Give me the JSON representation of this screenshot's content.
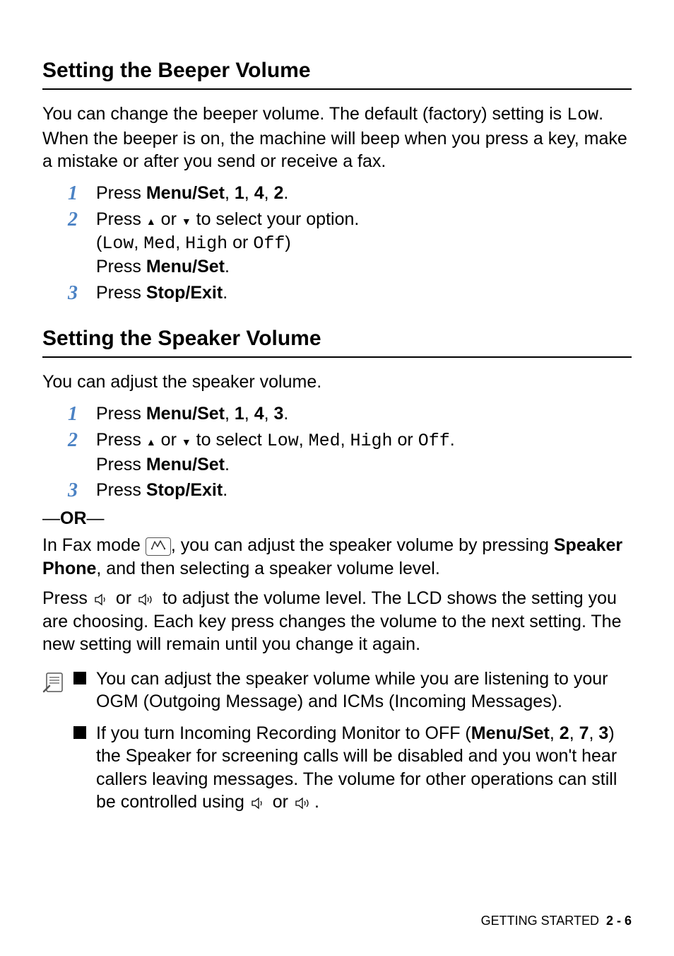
{
  "sections": {
    "beeper": {
      "heading": "Setting the Beeper Volume",
      "intro_pre": "You can change the beeper volume. The default (factory) setting is ",
      "intro_low": "Low",
      "intro_post": ". When the beeper is on, the machine will beep when you press a key, make a mistake or after you send or receive a fax.",
      "step1_pre": "Press ",
      "step1_bold": "Menu/Set",
      "step1_post": ", ",
      "step1_k1": "1",
      "step1_c1": ", ",
      "step1_k2": "4",
      "step1_c2": ", ",
      "step1_k3": "2",
      "step1_end": ".",
      "step2a": "Press ",
      "step2b": " or ",
      "step2c": " to select your option.",
      "step2_paren_open": "(",
      "step2_low": "Low",
      "step2_sep1": ", ",
      "step2_med": "Med",
      "step2_sep2": ", ",
      "step2_high": "High",
      "step2_or": " or ",
      "step2_off": "Off",
      "step2_paren_close": ")",
      "step2_press": "Press ",
      "step2_ms": "Menu/Set",
      "step2_dot": ".",
      "step3_pre": "Press ",
      "step3_bold": "Stop/Exit",
      "step3_post": "."
    },
    "speaker": {
      "heading": "Setting the Speaker Volume",
      "intro": "You can adjust the speaker volume.",
      "step1_pre": "Press ",
      "step1_bold": "Menu/Set",
      "step1_post": ", ",
      "step1_k1": "1",
      "step1_c1": ", ",
      "step1_k2": "4",
      "step1_c2": ", ",
      "step1_k3": "3",
      "step1_end": ".",
      "step2a": "Press ",
      "step2b": " or ",
      "step2c": " to select ",
      "step2_low": "Low",
      "step2_sep1": ", ",
      "step2_med": "Med",
      "step2_sep2": ", ",
      "step2_high": "High",
      "step2_or": " or ",
      "step2_off": "Off",
      "step2_dot": ".",
      "step2_press": "Press ",
      "step2_ms": "Menu/Set",
      "step2_dot2": ".",
      "step3_pre": "Press ",
      "step3_bold": "Stop/Exit",
      "step3_post": ".",
      "or_label": "—OR—",
      "fax_pre": "In Fax mode ",
      "fax_mid": ", you can adjust the speaker volume by pressing ",
      "fax_bold": "Speaker Phone",
      "fax_post": ", and then selecting a speaker volume level.",
      "press_pre": "Press ",
      "press_or": " or ",
      "press_post": " to adjust the volume level. The LCD shows the setting you are choosing. Each key press changes the volume to the next setting. The new setting will remain until you change it again."
    },
    "notes": {
      "n1": "You can adjust the speaker volume while you are listening to your OGM (Outgoing Message) and ICMs (Incoming Messages).",
      "n2_pre": "If you turn Incoming Recording Monitor to OFF (",
      "n2_ms": "Menu/Set",
      "n2_c1": ", ",
      "n2_k1": "2",
      "n2_c2": ", ",
      "n2_k2": "7",
      "n2_c3": ", ",
      "n2_k3": "3",
      "n2_mid": ") the Speaker for screening calls will be disabled and you won't hear callers leaving messages. The volume for other operations can still be controlled using ",
      "n2_or": " or ",
      "n2_end": "."
    }
  },
  "nums": {
    "1": "1",
    "2": "2",
    "3": "3"
  },
  "footer": {
    "label": "GETTING STARTED",
    "page": "2 - 6"
  }
}
